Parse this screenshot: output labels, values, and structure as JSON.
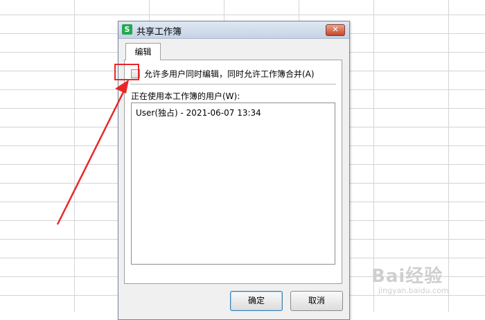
{
  "dialog": {
    "title": "共享工作簿",
    "app_icon_letter": "S",
    "close_label": "✕",
    "tab_label": "编辑",
    "checkbox_label": "允许多用户同时编辑，同时允许工作簿合并(A)",
    "checkbox_checked": false,
    "users_label": "正在使用本工作簿的用户(W):",
    "users": [
      "User(独占) - 2021-06-07 13:34"
    ],
    "ok_label": "确定",
    "cancel_label": "取消"
  },
  "annotation": {
    "color": "#e8262a",
    "target": "checkbox"
  },
  "watermark": {
    "brand": "Bai经验",
    "url": "jingyan.baidu.com"
  },
  "colors": {
    "app_icon": "#22a94f",
    "close_button": "#c5472a",
    "grid_line": "#d4d4d4"
  }
}
